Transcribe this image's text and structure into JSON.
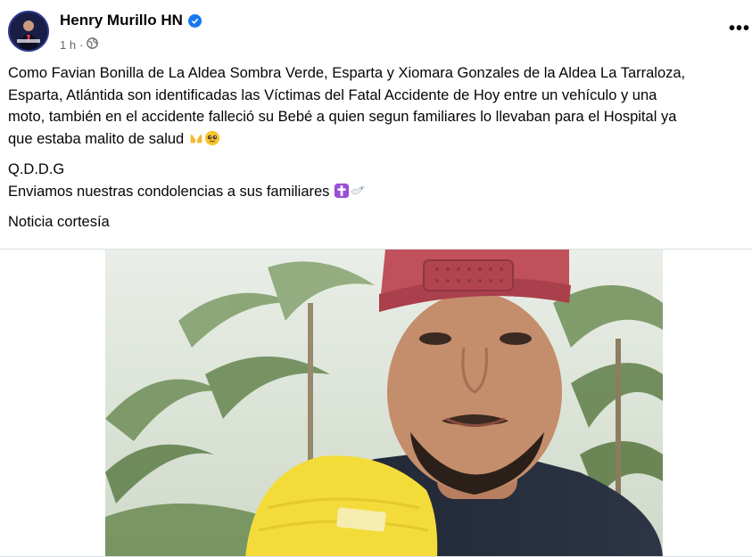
{
  "post": {
    "author": "Henry Murillo HN",
    "time": "1 h",
    "more_label": "•••",
    "text_lines": {
      "l1": "Como Favian Bonilla de La Aldea Sombra Verde, Esparta y Xiomara Gonzales de la Aldea La Tarraloza,",
      "l2": "Esparta, Atlántida son identificadas las Víctimas del Fatal Accidente de Hoy entre un vehículo y una",
      "l3": "moto, también en el accidente falleció su Bebé a quien segun familiares lo llevaban para el Hospital ya",
      "l4": "que estaba malito de salud",
      "l5": "Q.D.D.G",
      "l6": "Enviamos nuestras condolencias a sus familiares",
      "l7": "Noticia cortesía"
    }
  },
  "icons": {
    "verified": "verified-badge-icon",
    "globe": "globe-icon",
    "hands": "raised-hands-emoji",
    "pleading": "pleading-face-emoji",
    "cross": "latin-cross-emoji",
    "dove": "dove-emoji"
  },
  "colors": {
    "accent": "#1877f2",
    "secondary_text": "#65676b",
    "cap": "#c0505a",
    "beanie": "#f3dc3a"
  }
}
